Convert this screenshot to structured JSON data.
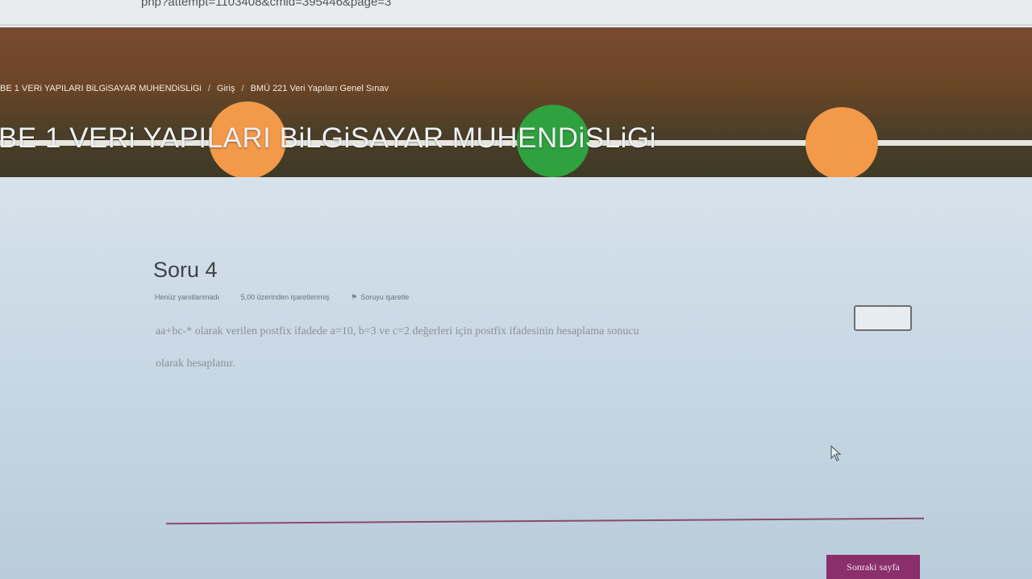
{
  "browser": {
    "url_fragment": "php?attempt=1103408&cmid=395446&page=3"
  },
  "breadcrumb": {
    "items": [
      "BE 1 VERi YAPILARI BiLGiSAYAR MUHENDiSLiGi",
      "Giriş",
      "BMÜ 221 Veri Yapıları Genel Sınav"
    ],
    "separator": "/"
  },
  "course": {
    "title": "BE 1 VERi YAPILARI BiLGiSAYAR MUHENDiSLiGi"
  },
  "question": {
    "title": "Soru 4",
    "status": "Henüz yanıtlanmadı",
    "points": "5,00 üzerinden işaretlenmiş",
    "flag_label": "Soruyu işaretle",
    "text_part1": "aa+bc-* olarak verilen postfix ifadede a=10, b=3 ve c=2 değerleri için postfix ifadesinin hesaplama sonucu",
    "text_part2": "olarak hesaplanır.",
    "answer_value": ""
  },
  "navigation": {
    "next_label": "Sonraki sayfa"
  },
  "colors": {
    "accent": "#8a2f6b",
    "circle_orange": "#f2994a",
    "circle_green": "#2fa23f"
  }
}
